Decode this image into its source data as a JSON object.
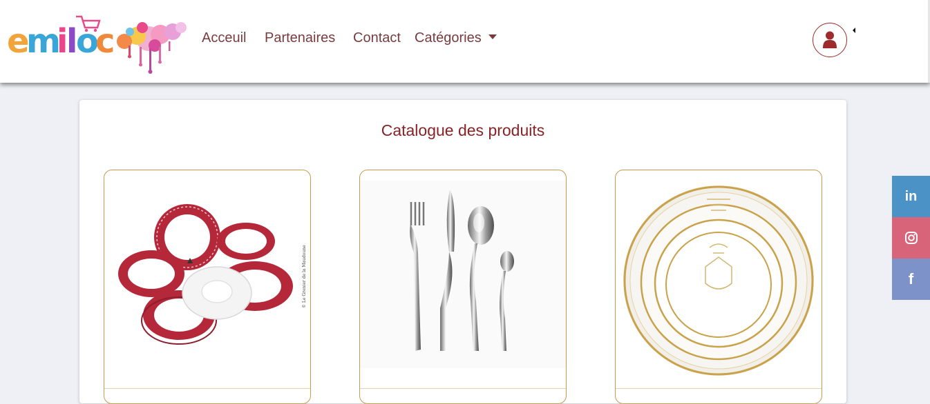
{
  "brand": {
    "logo_text": "emiloc",
    "colors": {
      "accent": "#9e2a2b",
      "nav_text": "#7a3b3f",
      "card_border": "#c89a4e"
    }
  },
  "nav": {
    "items": [
      {
        "label": "Acceuil"
      },
      {
        "label": "Partenaires"
      },
      {
        "label": "Contact"
      },
      {
        "label": "Catégories"
      }
    ],
    "user_icon": "user-icon"
  },
  "catalog": {
    "title": "Catalogue des produits",
    "products": [
      {
        "image": "red-patterned-plates-set",
        "image_caption": "© Le Grenier de la Maudoune"
      },
      {
        "image": "stainless-cutlery-set"
      },
      {
        "image": "gold-rim-porcelain-plates"
      }
    ]
  },
  "social": [
    {
      "name": "linkedin-icon",
      "label": "in",
      "color": "#4b93c6"
    },
    {
      "name": "instagram-icon",
      "label": "",
      "color": "#d8647a"
    },
    {
      "name": "facebook-icon",
      "label": "f",
      "color": "#7d92c8"
    }
  ]
}
